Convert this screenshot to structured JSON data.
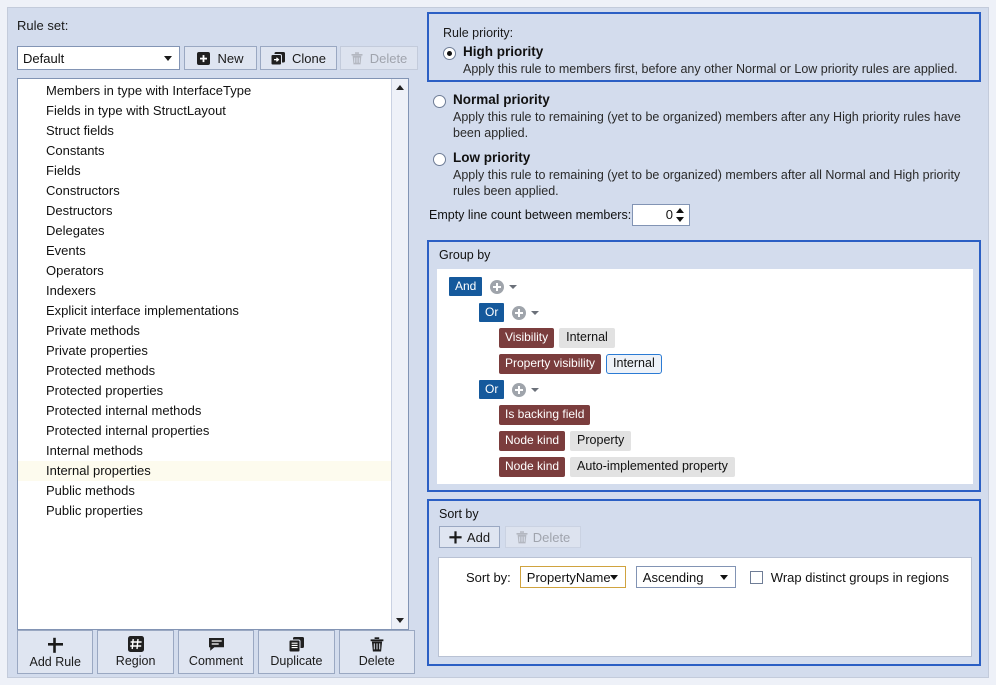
{
  "left": {
    "rule_set_label": "Rule set:",
    "combo_value": "Default",
    "buttons": [
      {
        "label": "New",
        "icon": "plus-square-icon",
        "disabled": false
      },
      {
        "label": "Clone",
        "icon": "clone-icon",
        "disabled": false
      },
      {
        "label": "Delete",
        "icon": "trash-icon",
        "disabled": true
      }
    ],
    "rules": [
      "Members in type with InterfaceType",
      "Fields in type with StructLayout",
      "Struct fields",
      "Constants",
      "Fields",
      "Constructors",
      "Destructors",
      "Delegates",
      "Events",
      "Operators",
      "Indexers",
      "Explicit interface implementations",
      "Private methods",
      "Private properties",
      "Protected methods",
      "Protected properties",
      "Protected internal methods",
      "Protected internal properties",
      "Internal methods",
      "Internal properties",
      "Public methods",
      "Public properties"
    ],
    "selected_rule": "Internal properties",
    "toolbar": [
      {
        "label": "Add Rule",
        "icon": "plus-icon"
      },
      {
        "label": "Region",
        "icon": "hash-icon"
      },
      {
        "label": "Comment",
        "icon": "comment-icon"
      },
      {
        "label": "Duplicate",
        "icon": "duplicate-icon"
      },
      {
        "label": "Delete",
        "icon": "trash-icon"
      }
    ]
  },
  "priority": {
    "title": "Rule priority:",
    "options": [
      {
        "label": "High priority",
        "description": "Apply this rule to members first, before any other Normal or Low priority rules are applied.",
        "selected": true
      },
      {
        "label": "Normal priority",
        "description": "Apply this rule to remaining (yet to be organized) members after any High priority rules have been applied.",
        "selected": false
      },
      {
        "label": "Low priority",
        "description": "Apply this rule to remaining (yet to be organized) members after all Normal and High priority rules been applied.",
        "selected": false
      }
    ],
    "empty_line_label": "Empty line count between members:",
    "empty_line_value": "0"
  },
  "group_by": {
    "title": "Group by",
    "root_operator": "And",
    "branches": [
      {
        "operator": "Or",
        "conditions": [
          {
            "key": "Visibility",
            "value": "Internal",
            "focused": false
          },
          {
            "key": "Property visibility",
            "value": "Internal",
            "focused": true
          }
        ]
      },
      {
        "operator": "Or",
        "conditions": [
          {
            "key": "Is backing field",
            "value": "",
            "focused": false
          },
          {
            "key": "Node kind",
            "value": "Property",
            "focused": false
          },
          {
            "key": "Node kind",
            "value": "Auto-implemented property",
            "focused": false
          }
        ]
      }
    ]
  },
  "sort_by": {
    "title": "Sort by",
    "add_label": "Add",
    "delete_label": "Delete",
    "row_label": "Sort by:",
    "field_value": "PropertyName",
    "direction_value": "Ascending",
    "wrap_label": "Wrap distinct groups in regions",
    "wrap_checked": false
  },
  "colors": {
    "accent_blue": "#2b5fc4",
    "operator_chip": "#15599c",
    "key_chip": "#7b3d3d",
    "value_chip": "#e2e2e2",
    "selection_highlight": "#fdfbee",
    "panel_bg": "#d3dced"
  }
}
